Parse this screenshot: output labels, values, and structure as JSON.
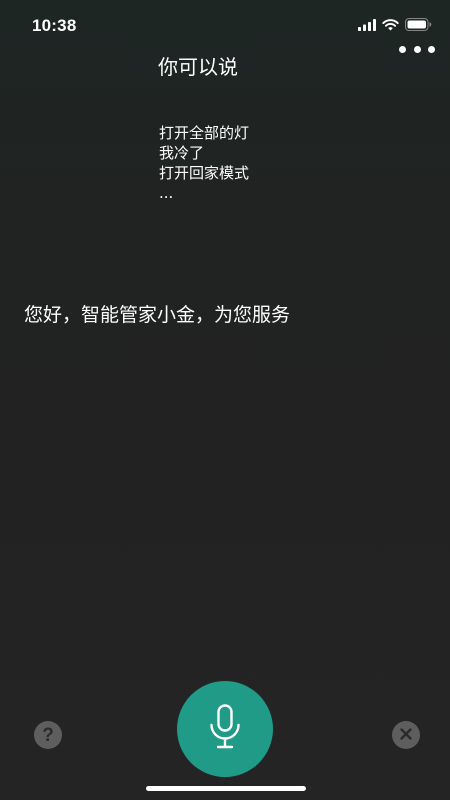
{
  "status_bar": {
    "time": "10:38",
    "icons": [
      "cellular-signal-icon",
      "wifi-icon",
      "battery-icon"
    ]
  },
  "header": {
    "more_icon": "more-dots-icon"
  },
  "hints": {
    "title": "你可以说",
    "items": [
      "打开全部的灯",
      "我冷了",
      "打开回家模式",
      "..."
    ]
  },
  "greeting": "您好，智能管家小金，为您服务",
  "bottom_bar": {
    "help_label": "?",
    "help_icon": "question-mark-icon",
    "mic_icon": "microphone-icon",
    "close_icon": "close-icon"
  },
  "colors": {
    "accent": "#1f9b88",
    "secondary_button": "#5e5e5e",
    "text": "#ffffff"
  }
}
